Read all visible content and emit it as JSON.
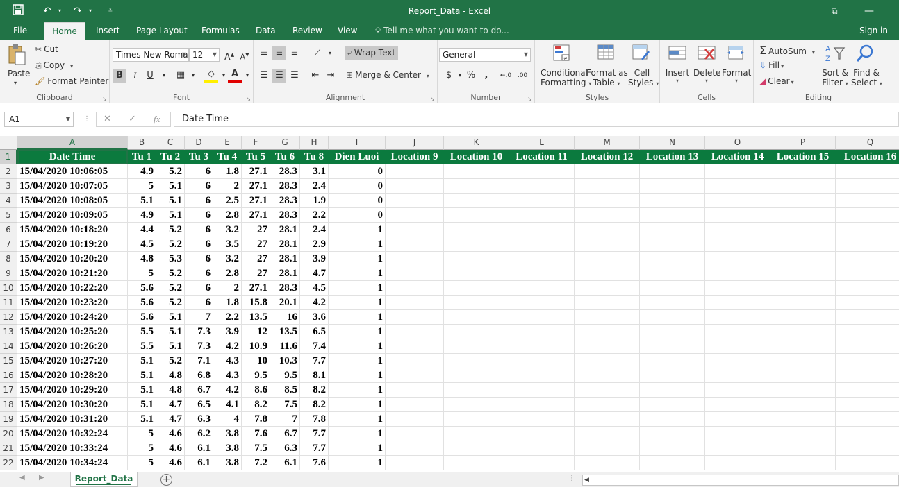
{
  "window": {
    "title": "Report_Data - Excel"
  },
  "tabs": [
    "File",
    "Home",
    "Insert",
    "Page Layout",
    "Formulas",
    "Data",
    "Review",
    "View"
  ],
  "active_tab": "Home",
  "tell_me": "Tell me what you want to do...",
  "sign_in": "Sign in",
  "ribbon": {
    "clipboard": {
      "label": "Clipboard",
      "paste": "Paste",
      "cut": "Cut",
      "copy": "Copy",
      "format_painter": "Format Painter"
    },
    "font": {
      "label": "Font",
      "name": "Times New Roma",
      "size": "12",
      "bold": "B",
      "italic": "I",
      "underline": "U"
    },
    "alignment": {
      "label": "Alignment",
      "wrap": "Wrap Text",
      "merge": "Merge & Center"
    },
    "number": {
      "label": "Number",
      "format": "General",
      "currency": "$",
      "percent": "%",
      "comma": ","
    },
    "styles": {
      "label": "Styles",
      "conditional": "Conditional",
      "conditional2": "Formatting",
      "format_table": "Format as",
      "format_table2": "Table",
      "cell_styles": "Cell",
      "cell_styles2": "Styles"
    },
    "cells": {
      "label": "Cells",
      "insert": "Insert",
      "delete": "Delete",
      "format": "Format"
    },
    "editing": {
      "label": "Editing",
      "autosum": "AutoSum",
      "fill": "Fill",
      "clear": "Clear",
      "sort": "Sort &",
      "sort2": "Filter",
      "find": "Find &",
      "find2": "Select"
    }
  },
  "formula_bar": {
    "name_box": "A1",
    "fx": "fx",
    "value": "Date Time"
  },
  "columns": [
    "A",
    "B",
    "C",
    "D",
    "E",
    "F",
    "G",
    "H",
    "I",
    "J",
    "K",
    "L",
    "M",
    "N",
    "O",
    "P",
    "Q"
  ],
  "header_row": [
    "Date Time",
    "Tu 1",
    "Tu 2",
    "Tu 3",
    "Tu 4",
    "Tu 5",
    "Tu 6",
    "Tu 8",
    "Dien Luoi",
    "Location 9",
    "Location 10",
    "Location 11",
    "Location 12",
    "Location 13",
    "Location 14",
    "Location 15",
    "Location 16"
  ],
  "rows": [
    [
      "15/04/2020 10:06:05",
      "4.9",
      "5.2",
      "6",
      "1.8",
      "27.1",
      "28.3",
      "3.1",
      "0"
    ],
    [
      "15/04/2020 10:07:05",
      "5",
      "5.1",
      "6",
      "2",
      "27.1",
      "28.3",
      "2.4",
      "0"
    ],
    [
      "15/04/2020 10:08:05",
      "5.1",
      "5.1",
      "6",
      "2.5",
      "27.1",
      "28.3",
      "1.9",
      "0"
    ],
    [
      "15/04/2020 10:09:05",
      "4.9",
      "5.1",
      "6",
      "2.8",
      "27.1",
      "28.3",
      "2.2",
      "0"
    ],
    [
      "15/04/2020 10:18:20",
      "4.4",
      "5.2",
      "6",
      "3.2",
      "27",
      "28.1",
      "2.4",
      "1"
    ],
    [
      "15/04/2020 10:19:20",
      "4.5",
      "5.2",
      "6",
      "3.5",
      "27",
      "28.1",
      "2.9",
      "1"
    ],
    [
      "15/04/2020 10:20:20",
      "4.8",
      "5.3",
      "6",
      "3.2",
      "27",
      "28.1",
      "3.9",
      "1"
    ],
    [
      "15/04/2020 10:21:20",
      "5",
      "5.2",
      "6",
      "2.8",
      "27",
      "28.1",
      "4.7",
      "1"
    ],
    [
      "15/04/2020 10:22:20",
      "5.6",
      "5.2",
      "6",
      "2",
      "27.1",
      "28.3",
      "4.5",
      "1"
    ],
    [
      "15/04/2020 10:23:20",
      "5.6",
      "5.2",
      "6",
      "1.8",
      "15.8",
      "20.1",
      "4.2",
      "1"
    ],
    [
      "15/04/2020 10:24:20",
      "5.6",
      "5.1",
      "7",
      "2.2",
      "13.5",
      "16",
      "3.6",
      "1"
    ],
    [
      "15/04/2020 10:25:20",
      "5.5",
      "5.1",
      "7.3",
      "3.9",
      "12",
      "13.5",
      "6.5",
      "1"
    ],
    [
      "15/04/2020 10:26:20",
      "5.5",
      "5.1",
      "7.3",
      "4.2",
      "10.9",
      "11.6",
      "7.4",
      "1"
    ],
    [
      "15/04/2020 10:27:20",
      "5.1",
      "5.2",
      "7.1",
      "4.3",
      "10",
      "10.3",
      "7.7",
      "1"
    ],
    [
      "15/04/2020 10:28:20",
      "5.1",
      "4.8",
      "6.8",
      "4.3",
      "9.5",
      "9.5",
      "8.1",
      "1"
    ],
    [
      "15/04/2020 10:29:20",
      "5.1",
      "4.8",
      "6.7",
      "4.2",
      "8.6",
      "8.5",
      "8.2",
      "1"
    ],
    [
      "15/04/2020 10:30:20",
      "5.1",
      "4.7",
      "6.5",
      "4.1",
      "8.2",
      "7.5",
      "8.2",
      "1"
    ],
    [
      "15/04/2020 10:31:20",
      "5.1",
      "4.7",
      "6.3",
      "4",
      "7.8",
      "7",
      "7.8",
      "1"
    ],
    [
      "15/04/2020 10:32:24",
      "5",
      "4.6",
      "6.2",
      "3.8",
      "7.6",
      "6.7",
      "7.7",
      "1"
    ],
    [
      "15/04/2020 10:33:24",
      "5",
      "4.6",
      "6.1",
      "3.8",
      "7.5",
      "6.3",
      "7.7",
      "1"
    ],
    [
      "15/04/2020 10:34:24",
      "5",
      "4.6",
      "6.1",
      "3.8",
      "7.2",
      "6.1",
      "7.6",
      "1"
    ]
  ],
  "sheet_tab": "Report_Data",
  "colors": {
    "accent": "#217346",
    "header_fill": "#0b7a3e"
  }
}
